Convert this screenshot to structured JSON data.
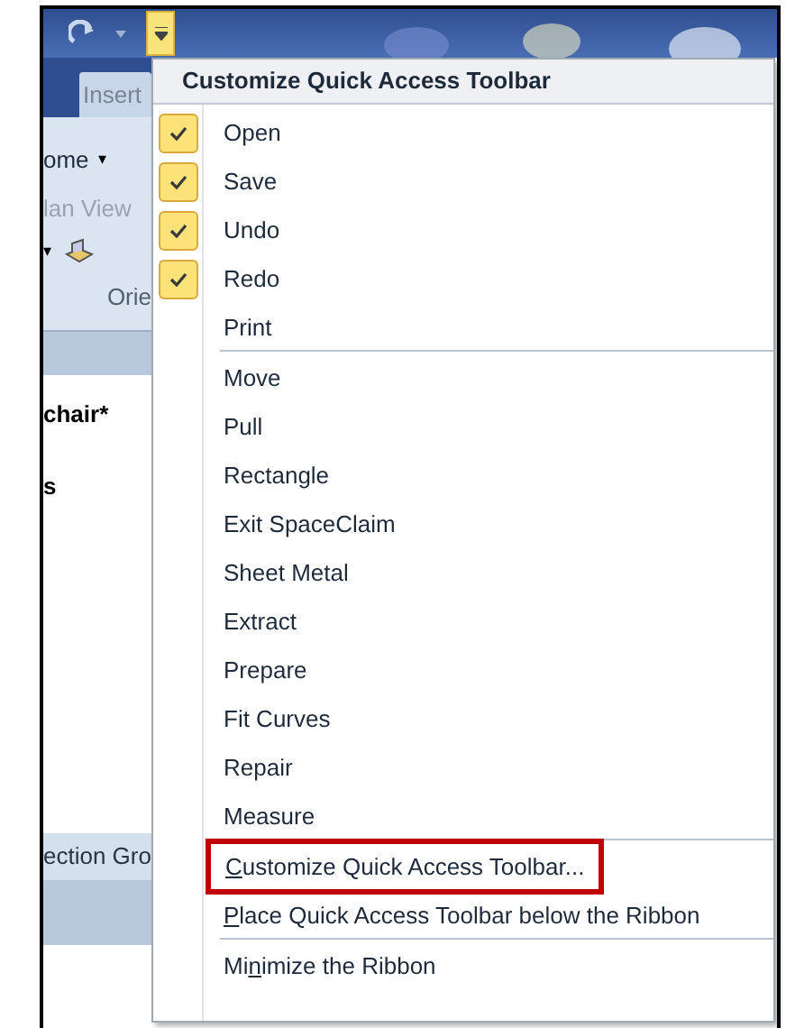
{
  "window": {
    "tab": "Insert",
    "ribbon": {
      "home_menu": "ome",
      "caret": "▾",
      "plan_view": "lan View",
      "orient_group": "Orie"
    },
    "panel_title": "chair*",
    "panel_text": "s",
    "section_group": "ection Gro"
  },
  "menu": {
    "title": "Customize Quick Access Toolbar",
    "sections": [
      {
        "items": [
          {
            "label": "Open",
            "checked": true
          },
          {
            "label": "Save",
            "checked": true
          },
          {
            "label": "Undo",
            "checked": true
          },
          {
            "label": "Redo",
            "checked": true
          },
          {
            "label": "Print",
            "checked": false
          }
        ]
      },
      {
        "items": [
          {
            "label": "Move"
          },
          {
            "label": "Pull"
          },
          {
            "label": "Rectangle"
          },
          {
            "label": "Exit SpaceClaim"
          },
          {
            "label": "Sheet Metal"
          },
          {
            "label": "Extract"
          },
          {
            "label": "Prepare"
          },
          {
            "label": "Fit Curves"
          },
          {
            "label": "Repair"
          },
          {
            "label": "Measure"
          }
        ]
      },
      {
        "items": [
          {
            "accel": "C",
            "suffix": "ustomize Quick Access Toolbar...",
            "highlighted": true
          },
          {
            "accel": "P",
            "suffix": "lace Quick Access Toolbar below the Ribbon",
            "highlighted": false
          }
        ]
      },
      {
        "items": [
          {
            "prefix": "Mi",
            "accel": "n",
            "suffix": "imize the Ribbon",
            "highlighted": false
          }
        ]
      }
    ]
  }
}
